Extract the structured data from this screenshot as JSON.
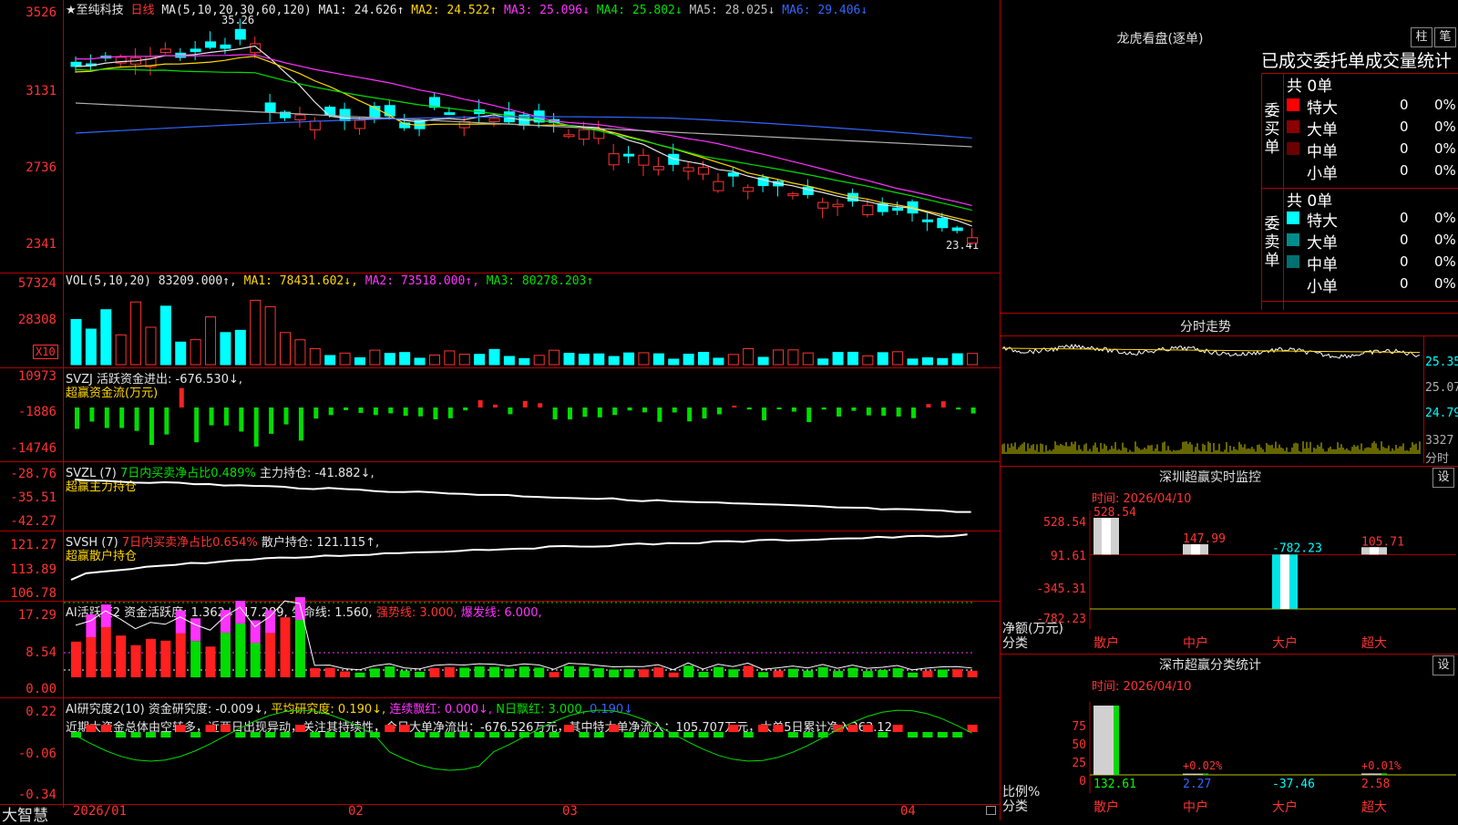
{
  "main": {
    "stock_title": "★至纯科技",
    "period": "日线",
    "ma_params": "MA(5,10,20,30,60,120)",
    "ma": [
      {
        "label": "MA1: 24.626↑",
        "color": "#e6e6e6"
      },
      {
        "label": "MA2: 24.522↑",
        "color": "#ffd700"
      },
      {
        "label": "MA3: 25.096↓",
        "color": "#ff33ff"
      },
      {
        "label": "MA4: 25.802↓",
        "color": "#00e000"
      },
      {
        "label": "MA5: 28.025↓",
        "color": "#c0c0c0"
      },
      {
        "label": "MA6: 29.406↓",
        "color": "#3366ff"
      }
    ],
    "yticks": [
      "3526",
      "3131",
      "2736",
      "2341"
    ],
    "high_marker": "35.26",
    "low_marker": "23.41"
  },
  "vol": {
    "legend_a": "VOL(5,10,20) 83209.000↑,",
    "legend_b": "MA1: 78431.602↓,",
    "legend_c": "MA2: 73518.000↑,",
    "legend_d": "MA3: 80278.203↑",
    "yticks": [
      "57324",
      "28308"
    ],
    "unit": "X10"
  },
  "svzj": {
    "legend": "SVZJ  活跃资金进出: -676.530↓,",
    "sub": "超赢资金流(万元)",
    "yticks": [
      "10973",
      "-1886",
      "-14746"
    ]
  },
  "svzl": {
    "legend_a": "SVZL (7)",
    "legend_b": "7日内买卖净占比0.489%",
    "legend_c": "主力持仓: -41.882↓,",
    "sub": "超赢主力持仓",
    "yticks": [
      "-28.76",
      "-35.51",
      "-42.27"
    ]
  },
  "svsh": {
    "legend_a": "SVSH (7)",
    "legend_b": "7日内买卖净占比0.654%",
    "legend_c": "散户持仓: 121.115↑,",
    "sub": "超赢散户持仓",
    "yticks": [
      "121.27",
      "113.89",
      "106.78"
    ]
  },
  "ai1": {
    "legend_a": "AI活跃度2 资金活跃度: 1.362↓,",
    "legend_b": "17.289,",
    "legend_c": "生命线: 1.560,",
    "legend_d": "强势线: 3.000,",
    "legend_e": "爆发线: 6.000,",
    "yticks": [
      "17.29",
      "8.54",
      "0.00"
    ]
  },
  "ai2": {
    "legend_a": "AI研究度2(10) 资金研究度: -0.009↓,",
    "legend_b": "平均研究度: 0.190↓,",
    "legend_c": "连续飘红: 0.000↓,",
    "legend_d": "N日飘红: 3.000,",
    "legend_e": "0.190↓",
    "note": "近期大资金总体由空转多，近两日出现异动，关注其持续性，今日大单净流出：-676.526万元，其中特大单净流入：105.707万元，大单5日累计净入363.12",
    "yticks": [
      "0.22",
      "-0.06",
      "-0.34"
    ]
  },
  "xaxis": {
    "brand": "大智慧",
    "labels": [
      "2026/01",
      "02",
      "03",
      "04"
    ]
  },
  "right": {
    "lhb_title": "龙虎看盘(逐单)",
    "btn_a": "柱",
    "btn_b": "笔",
    "stat_title": "已成交委托单成交量统计",
    "buy_label": "委买单",
    "sell_label": "委卖单",
    "buy_total": "共 0单",
    "sell_total": "共 0单",
    "buy_rows": [
      {
        "name": "特大",
        "count": "0",
        "pct": "0%",
        "color": "#ff0000"
      },
      {
        "name": "大单",
        "count": "0",
        "pct": "0%",
        "color": "#8b0000"
      },
      {
        "name": "中单",
        "count": "0",
        "pct": "0%",
        "color": "#6b0000"
      },
      {
        "name": "小单",
        "count": "0",
        "pct": "0%",
        "color": "#000000"
      }
    ],
    "sell_rows": [
      {
        "name": "特大",
        "count": "0",
        "pct": "0%",
        "color": "#00ffff"
      },
      {
        "name": "大单",
        "count": "0",
        "pct": "0%",
        "color": "#008b8b"
      },
      {
        "name": "中单",
        "count": "0",
        "pct": "0%",
        "color": "#007070"
      },
      {
        "name": "小单",
        "count": "0",
        "pct": "0%",
        "color": "#000000"
      }
    ],
    "intraday_title": "分时走势",
    "intraday_ticks": [
      "25.35",
      "25.07",
      "24.79",
      "3327",
      "分时"
    ],
    "monitor_title": "深圳超赢实时监控",
    "monitor_btn": "设",
    "monitor_time": "时间: 2026/04/10",
    "monitor_yticks": [
      "528.54",
      "91.61",
      "-345.31",
      "-782.23"
    ],
    "monitor_ylabel_a": "净额(万元)",
    "monitor_ylabel_b": "分类",
    "monitor_bars": [
      {
        "cat": "散户",
        "value": 528.54,
        "label": "528.54"
      },
      {
        "cat": "中户",
        "value": 147.99,
        "label": "147.99"
      },
      {
        "cat": "大户",
        "value": -782.23,
        "label": "-782.23"
      },
      {
        "cat": "超大",
        "value": 105.71,
        "label": "105.71"
      }
    ],
    "class_title": "深市超赢分类统计",
    "class_btn": "设",
    "class_time": "时间: 2026/04/10",
    "class_yticks": [
      "75",
      "50",
      "25",
      "0"
    ],
    "class_ylabel_a": "比例%",
    "class_ylabel_b": "分类",
    "class_bars": [
      {
        "cat": "散户",
        "value": 132.61,
        "label": "132.61",
        "pct_label": ""
      },
      {
        "cat": "中户",
        "value": 2.27,
        "label": "2.27",
        "pct_label": "+0.02%"
      },
      {
        "cat": "大户",
        "value": -37.46,
        "label": "-37.46",
        "pct_label": ""
      },
      {
        "cat": "超大",
        "value": 2.58,
        "label": "2.58",
        "pct_label": "+0.01%"
      }
    ]
  }
}
